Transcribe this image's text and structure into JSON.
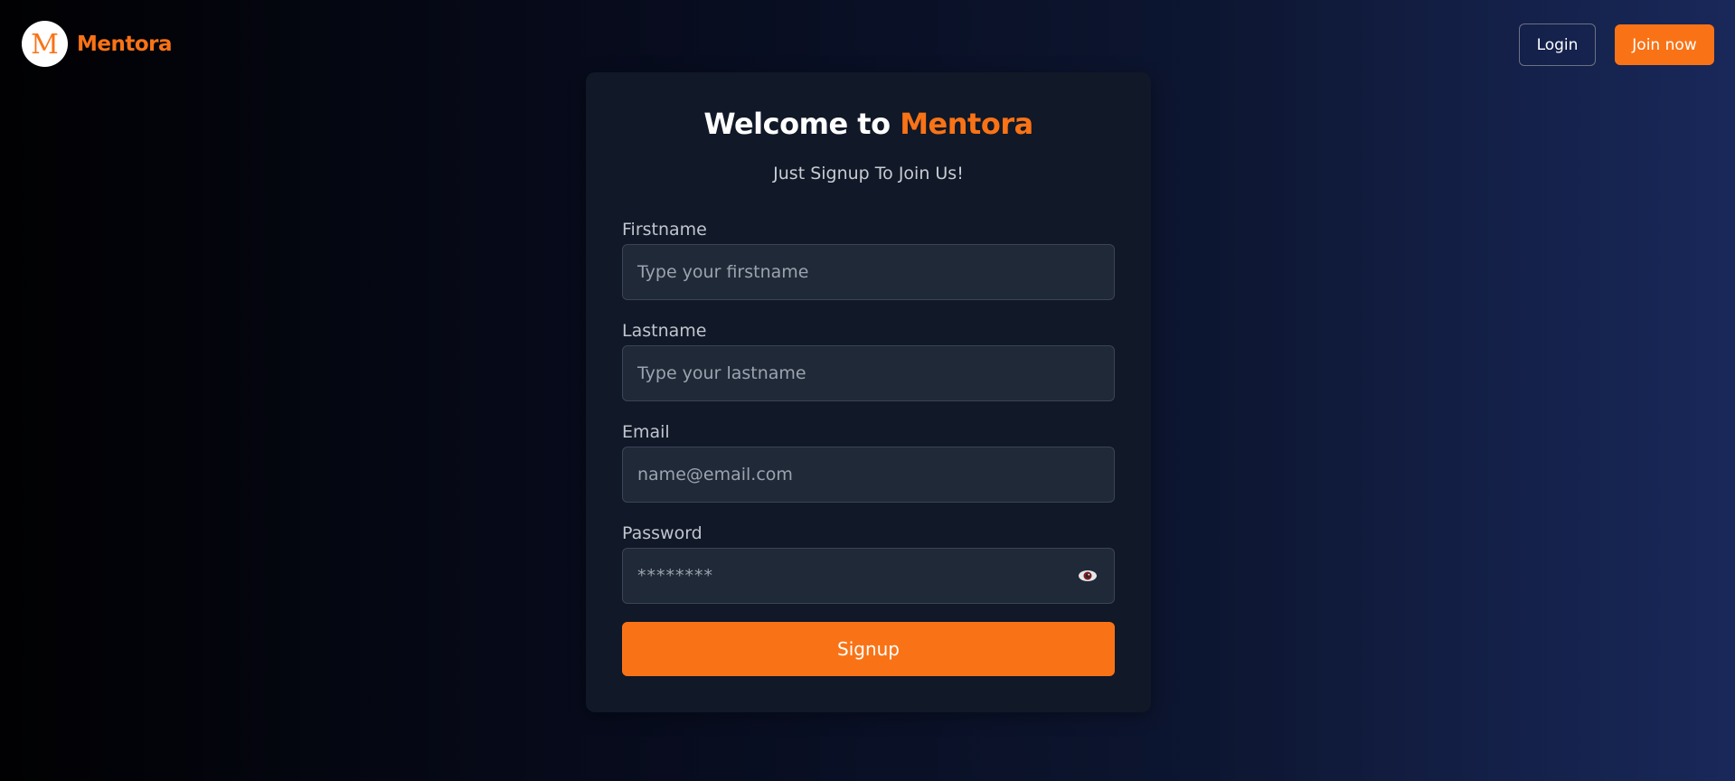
{
  "brand": {
    "logo_letter": "M",
    "name": "Mentora",
    "accent_color": "#f97316"
  },
  "nav": {
    "login_label": "Login",
    "join_label": "Join now"
  },
  "form": {
    "title_prefix": "Welcome to",
    "title_brand": "Mentora",
    "subtitle": "Just Signup To Join Us!",
    "fields": [
      {
        "label": "Firstname",
        "placeholder": "Type your firstname"
      },
      {
        "label": "Lastname",
        "placeholder": "Type your lastname"
      },
      {
        "label": "Email",
        "placeholder": "name@email.com"
      },
      {
        "label": "Password",
        "value": "********",
        "icon": "eye-icon"
      }
    ],
    "submit_label": "Signup"
  }
}
